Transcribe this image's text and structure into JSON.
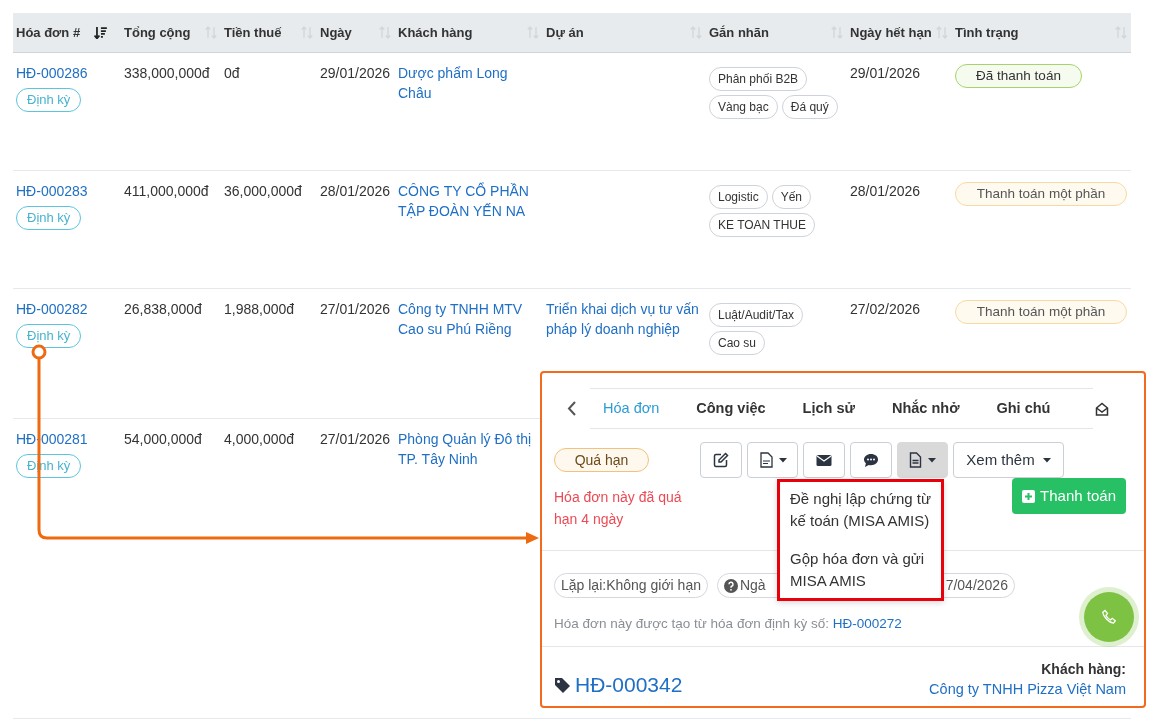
{
  "table": {
    "columns": [
      {
        "label": "Hóa đơn #",
        "sorted": true
      },
      {
        "label": "Tổng cộng",
        "sorted": false
      },
      {
        "label": "Tiền thuế",
        "sorted": false
      },
      {
        "label": "Ngày",
        "sorted": false
      },
      {
        "label": "Khách hàng",
        "sorted": false
      },
      {
        "label": "Dự án",
        "sorted": false
      },
      {
        "label": "Gắn nhãn",
        "sorted": false
      },
      {
        "label": "Ngày hết hạn",
        "sorted": false
      },
      {
        "label": "Tình trạng",
        "sorted": false
      }
    ],
    "rows": [
      {
        "number": "HĐ-000286",
        "badge": "Định kỳ",
        "total": "338,000,000đ",
        "tax": "0đ",
        "date": "29/01/2026",
        "customer": "Dược phẩm Long Châu",
        "tags": [
          "Phân phối B2B",
          "Vàng bạc",
          "Đá quý"
        ],
        "due": "29/01/2026",
        "status": {
          "label": "Đã thanh toán",
          "kind": "paid"
        }
      },
      {
        "number": "HĐ-000283",
        "badge": "Định kỳ",
        "total": "411,000,000đ",
        "tax": "36,000,000đ",
        "date": "28/01/2026",
        "customer": "CÔNG TY CỔ PHẦN TẬP ĐOÀN YẾN NA",
        "tags": [
          "Logistic",
          "Yến",
          "KE TOAN THUE"
        ],
        "due": "28/01/2026",
        "status": {
          "label": "Thanh toán một phần",
          "kind": "partial"
        }
      },
      {
        "number": "HĐ-000282",
        "badge": "Định kỳ",
        "total": "26,838,000đ",
        "tax": "1,988,000đ",
        "date": "27/01/2026",
        "customer": "Công ty TNHH MTV Cao su Phú Riềng",
        "project": "Triển khai dịch vụ tư vấn pháp lý doanh nghiệp",
        "tags": [
          "Luật/Audit/Tax",
          "Cao su"
        ],
        "due": "27/02/2026",
        "status": {
          "label": "Thanh toán một phần",
          "kind": "partial"
        }
      },
      {
        "number": "HĐ-000281",
        "badge": "Định kỳ",
        "total": "54,000,000đ",
        "tax": "4,000,000đ",
        "date": "27/01/2026",
        "customer": "Phòng Quản lý Đô thị TP. Tây Ninh"
      }
    ]
  },
  "detail_panel": {
    "tabs": [
      {
        "label": "Hóa đơn",
        "selected": true
      },
      {
        "label": "Công việc",
        "selected": false
      },
      {
        "label": "Lịch sử",
        "selected": false
      },
      {
        "label": "Nhắc nhở",
        "selected": false
      },
      {
        "label": "Ghi chú",
        "selected": false
      }
    ],
    "status": "Quá hạn",
    "toolbar": [
      {
        "kind": "edit",
        "dropdown": false,
        "active": false
      },
      {
        "kind": "pdf",
        "dropdown": true,
        "active": false
      },
      {
        "kind": "email",
        "dropdown": false,
        "active": false
      },
      {
        "kind": "comment",
        "dropdown": false,
        "active": false
      },
      {
        "kind": "document",
        "dropdown": true,
        "active": true
      },
      {
        "kind": "text",
        "label": "Xem thêm",
        "dropdown": true,
        "active": false
      }
    ],
    "warning": "Hóa đơn này đã quá hạn 4 ngày",
    "pay_button": "Thanh toán",
    "menu": [
      "Đề nghị lập chứng từ kế toán (MISA AMIS)",
      "Gộp hóa đơn và gửi MISA AMIS"
    ],
    "pills": [
      {
        "kind": "plain",
        "parts": [
          "Lặp lại:Không giới hạn"
        ]
      },
      {
        "kind": "help",
        "parts": [
          "Ngà",
          "7/04/2026"
        ]
      }
    ],
    "origin_note": {
      "text": "Hóa đơn này được tạo từ hóa đơn định kỳ số:",
      "link": "HĐ-000272"
    },
    "invoice_number": "HĐ-000342",
    "customer_label": "Khách hàng:",
    "customer": "Công ty TNHH Pizza Việt Nam"
  }
}
